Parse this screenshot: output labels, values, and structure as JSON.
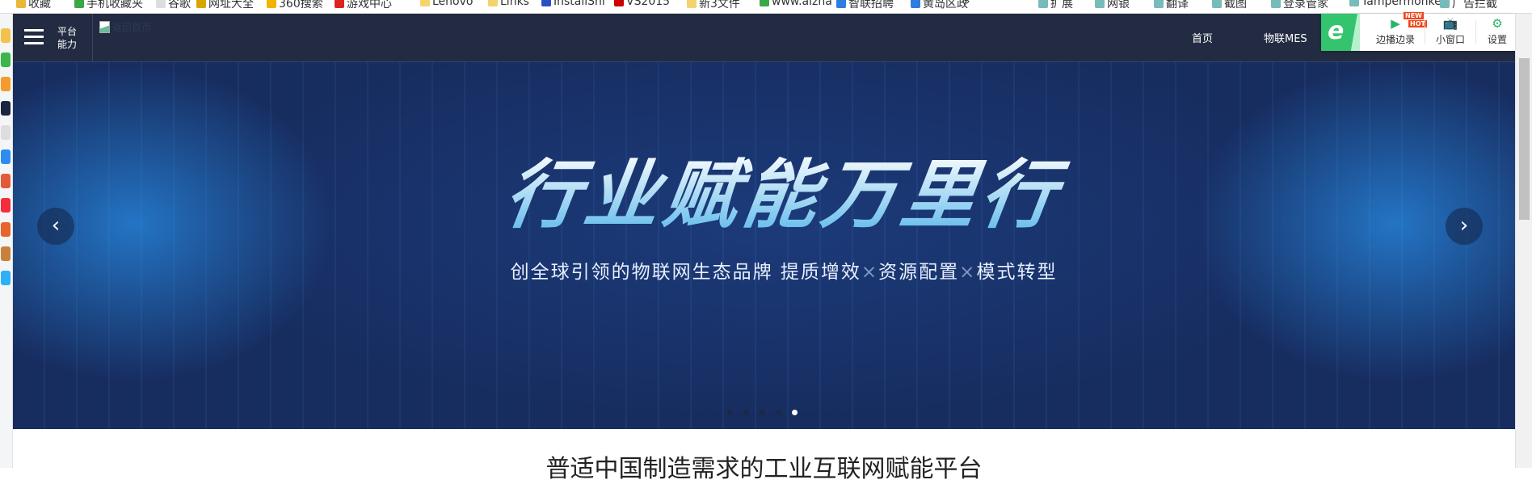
{
  "bookmarks": {
    "left": [
      "收藏",
      "手机收藏夹",
      "谷歌",
      "网址大全",
      "360搜索",
      "游戏中心",
      "Lenovo",
      "Links",
      "InstallShi",
      "VS2015",
      "新3文件",
      "www.aizha",
      "智联招聘",
      "黄岛区政"
    ],
    "more": "»",
    "right": [
      "扩展",
      "网银",
      "翻译",
      "截图",
      "登录管家",
      "Tampermonke",
      "广告拦截"
    ]
  },
  "header": {
    "menu_label": "平台能力",
    "logo_alt": "返回首页",
    "nav": [
      "首页",
      "物联MES"
    ]
  },
  "extension": {
    "logo": "e",
    "buttons": [
      {
        "label": "边播边录",
        "icon": "video-record-icon",
        "badges": [
          "NEW",
          "HOT"
        ]
      },
      {
        "label": "小窗口",
        "icon": "tv-icon"
      },
      {
        "label": "设置",
        "icon": "gear-icon"
      }
    ]
  },
  "banner": {
    "title": "行业赋能万里行",
    "subtitle_parts": [
      "创全球引领的物联网生态品牌  提质增效",
      "资源配置",
      "模式转型"
    ],
    "separator": "×",
    "prev": "‹",
    "next": "›",
    "slide_count": 5,
    "active_slide": 5
  },
  "section": {
    "title": "普适中国制造需求的工业互联网赋能平台"
  },
  "colors": {
    "header": "#222b41",
    "banner": "#172d60",
    "accent": "#35c46e"
  }
}
